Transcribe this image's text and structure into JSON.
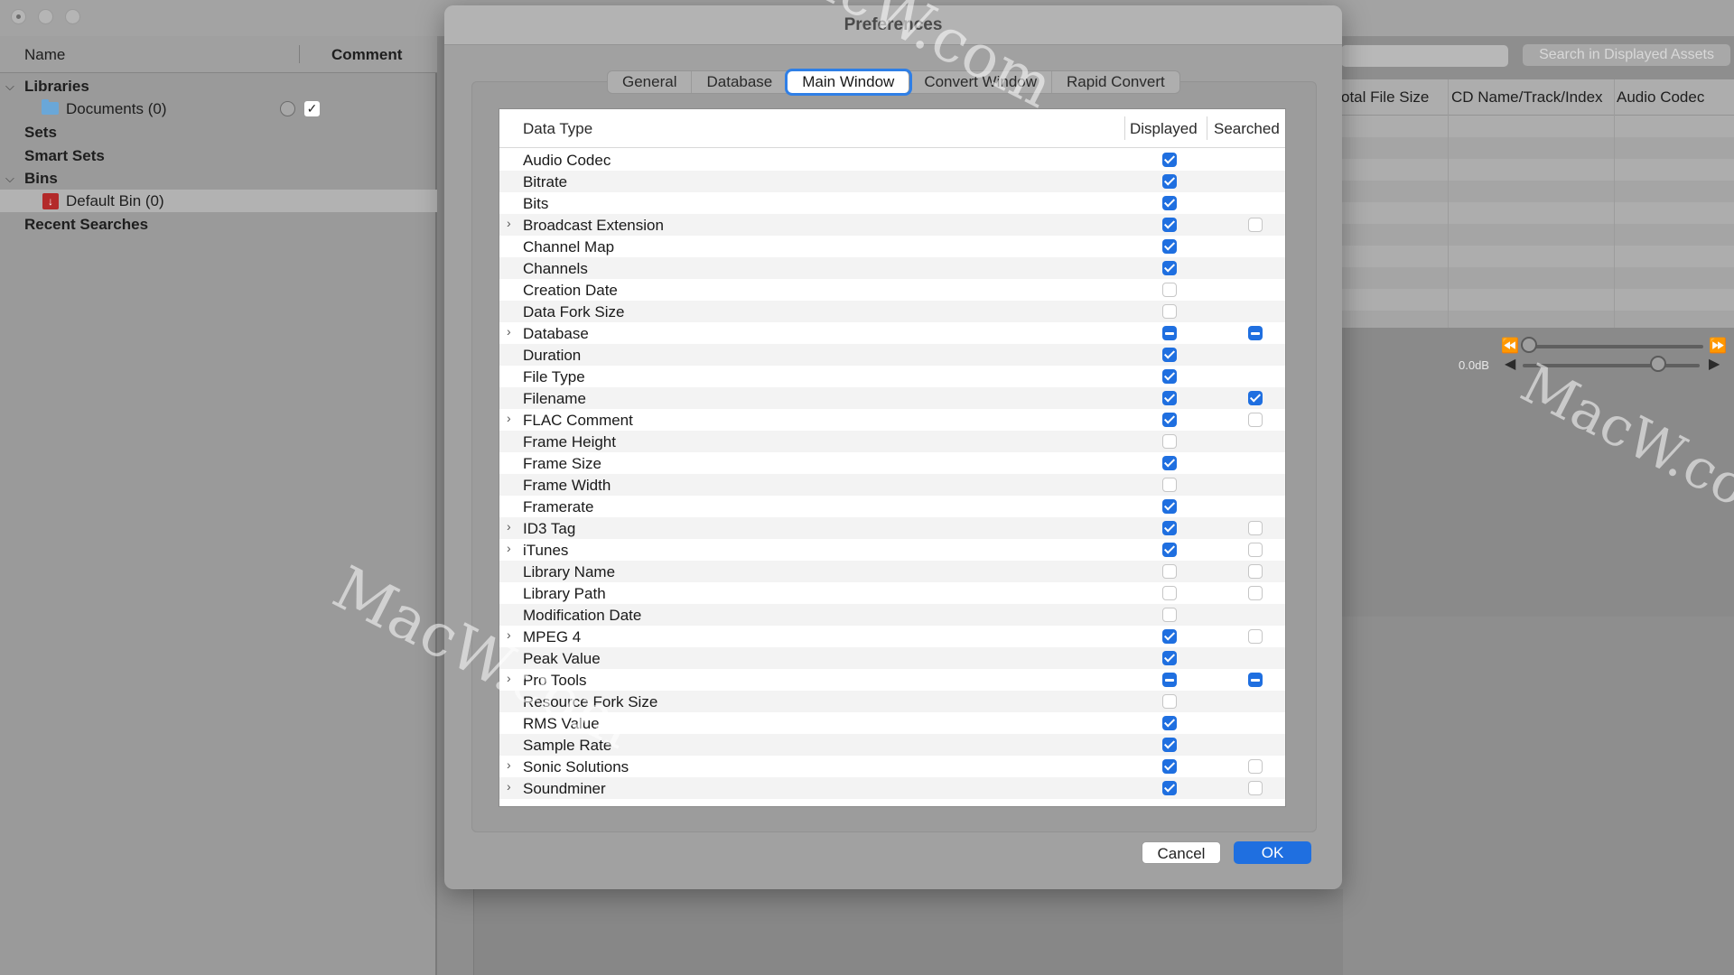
{
  "sidebar": {
    "col_name": "Name",
    "col_comment": "Comment",
    "items": [
      {
        "label": "Libraries"
      },
      {
        "label": "Documents (0)"
      },
      {
        "label": "Sets"
      },
      {
        "label": "Smart Sets"
      },
      {
        "label": "Bins"
      },
      {
        "label": "Default Bin (0)"
      },
      {
        "label": "Recent Searches"
      }
    ]
  },
  "main": {
    "search_placeholder": "Search in Displayed Assets",
    "columns": [
      "otal File Size",
      "CD Name/Track/Index",
      "Audio Codec"
    ],
    "gain_label": "0.0dB"
  },
  "dialog": {
    "title": "Preferences",
    "tabs": [
      "General",
      "Database",
      "Main Window",
      "Convert Window",
      "Rapid Convert"
    ],
    "active_tab": "Main Window",
    "columns": {
      "type": "Data Type",
      "displayed": "Displayed",
      "searched": "Searched"
    },
    "rows": [
      {
        "label": "Audio Codec",
        "expandable": false,
        "displayed": "on",
        "searched": "none"
      },
      {
        "label": "Bitrate",
        "expandable": false,
        "displayed": "on",
        "searched": "none"
      },
      {
        "label": "Bits",
        "expandable": false,
        "displayed": "on",
        "searched": "none"
      },
      {
        "label": "Broadcast Extension",
        "expandable": true,
        "displayed": "on",
        "searched": "off"
      },
      {
        "label": "Channel Map",
        "expandable": false,
        "displayed": "on",
        "searched": "none"
      },
      {
        "label": "Channels",
        "expandable": false,
        "displayed": "on",
        "searched": "none"
      },
      {
        "label": "Creation Date",
        "expandable": false,
        "displayed": "off",
        "searched": "none"
      },
      {
        "label": "Data Fork Size",
        "expandable": false,
        "displayed": "off",
        "searched": "none"
      },
      {
        "label": "Database",
        "expandable": true,
        "displayed": "mixed",
        "searched": "mixed"
      },
      {
        "label": "Duration",
        "expandable": false,
        "displayed": "on",
        "searched": "none"
      },
      {
        "label": "File Type",
        "expandable": false,
        "displayed": "on",
        "searched": "none"
      },
      {
        "label": "Filename",
        "expandable": false,
        "displayed": "on",
        "searched": "on"
      },
      {
        "label": "FLAC Comment",
        "expandable": true,
        "displayed": "on",
        "searched": "off"
      },
      {
        "label": "Frame Height",
        "expandable": false,
        "displayed": "off",
        "searched": "none"
      },
      {
        "label": "Frame Size",
        "expandable": false,
        "displayed": "on",
        "searched": "none"
      },
      {
        "label": "Frame Width",
        "expandable": false,
        "displayed": "off",
        "searched": "none"
      },
      {
        "label": "Framerate",
        "expandable": false,
        "displayed": "on",
        "searched": "none"
      },
      {
        "label": "ID3 Tag",
        "expandable": true,
        "displayed": "on",
        "searched": "off"
      },
      {
        "label": "iTunes",
        "expandable": true,
        "displayed": "on",
        "searched": "off"
      },
      {
        "label": "Library Name",
        "expandable": false,
        "displayed": "off",
        "searched": "off"
      },
      {
        "label": "Library Path",
        "expandable": false,
        "displayed": "off",
        "searched": "off"
      },
      {
        "label": "Modification Date",
        "expandable": false,
        "displayed": "off",
        "searched": "none"
      },
      {
        "label": "MPEG 4",
        "expandable": true,
        "displayed": "on",
        "searched": "off"
      },
      {
        "label": "Peak Value",
        "expandable": false,
        "displayed": "on",
        "searched": "none"
      },
      {
        "label": "Pro Tools",
        "expandable": true,
        "displayed": "mixed",
        "searched": "mixed"
      },
      {
        "label": "Resource Fork Size",
        "expandable": false,
        "displayed": "off",
        "searched": "none"
      },
      {
        "label": "RMS Value",
        "expandable": false,
        "displayed": "on",
        "searched": "none"
      },
      {
        "label": "Sample Rate",
        "expandable": false,
        "displayed": "on",
        "searched": "none"
      },
      {
        "label": "Sonic Solutions",
        "expandable": true,
        "displayed": "on",
        "searched": "off"
      },
      {
        "label": "Soundminer",
        "expandable": true,
        "displayed": "on",
        "searched": "off"
      }
    ],
    "cancel_label": "Cancel",
    "ok_label": "OK"
  },
  "watermark": "MacW.com",
  "colors": {
    "accent": "#1f6fe0",
    "dim_background": "#9a9a9a"
  }
}
